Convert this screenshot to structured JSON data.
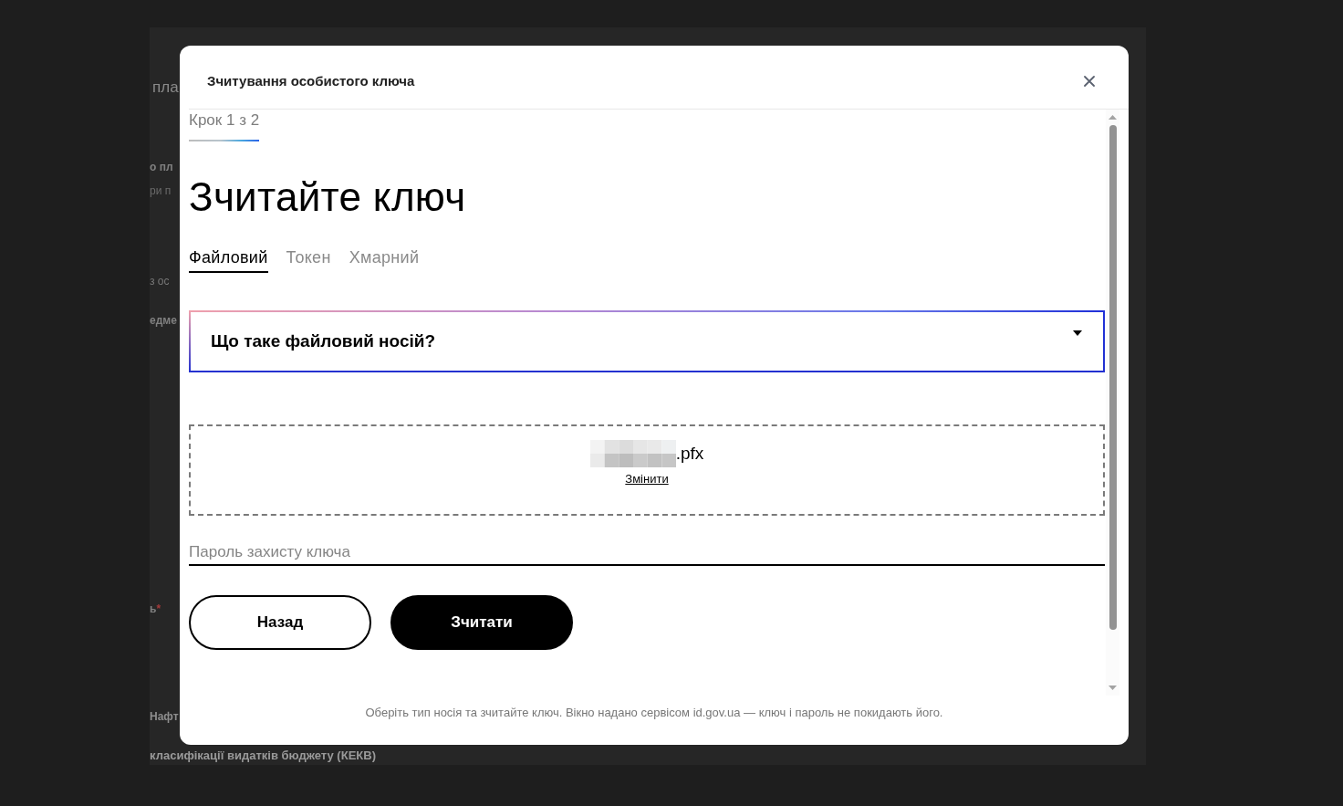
{
  "background_page": {
    "fragments": [
      {
        "kind": "heading",
        "text": "пла"
      },
      {
        "kind": "label",
        "text": "о пл"
      },
      {
        "kind": "hint",
        "text": "ри п"
      },
      {
        "kind": "value",
        "text": "з ос"
      },
      {
        "kind": "label",
        "text": "едме"
      },
      {
        "kind": "label",
        "text": "ь",
        "required_mark": "*"
      },
      {
        "kind": "value",
        "text": "Нафт"
      },
      {
        "kind": "label",
        "text": "класифікації видатків бюджету (КЕКВ)"
      }
    ]
  },
  "dialog": {
    "title": "Зчитування особистого ключа",
    "step": "Крок 1 з 2",
    "heading": "Зчитайте ключ",
    "tabs": [
      {
        "label": "Файловий",
        "selected": true
      },
      {
        "label": "Токен",
        "selected": false
      },
      {
        "label": "Хмарний",
        "selected": false
      }
    ],
    "accordion": {
      "title": "Що таке файловий носій?",
      "expanded": false
    },
    "file_drop": {
      "file_extension": ".pfx",
      "change_link": "Змінити"
    },
    "password_field": {
      "placeholder": "Пароль захисту ключа"
    },
    "buttons": [
      {
        "label": "Назад",
        "kind": "secondary"
      },
      {
        "label": "Зчитати",
        "kind": "primary"
      }
    ],
    "footer_note": "Оберіть тип носія та зчитайте ключ. Вікно надано сервісом id.gov.ua — ключ і пароль не покидають його."
  }
}
